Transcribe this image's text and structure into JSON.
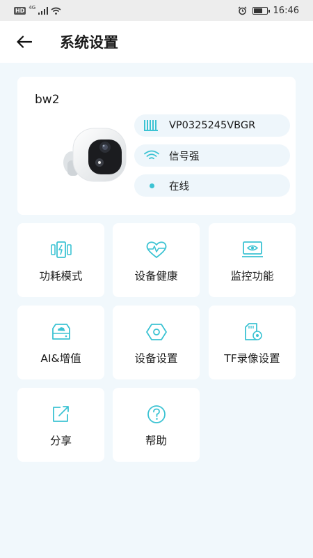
{
  "status_bar": {
    "network": "4G",
    "time": "16:46"
  },
  "header": {
    "title": "系统设置"
  },
  "device": {
    "name": "bw2",
    "serial": "VP0325245VBGR",
    "signal": "信号强",
    "status": "在线"
  },
  "menu": [
    {
      "label": "功耗模式",
      "icon": "battery-mode-icon"
    },
    {
      "label": "设备健康",
      "icon": "heart-pulse-icon"
    },
    {
      "label": "监控功能",
      "icon": "monitor-icon"
    },
    {
      "label": "AI&增值",
      "icon": "cloud-storage-icon"
    },
    {
      "label": "设备设置",
      "icon": "hexagon-settings-icon"
    },
    {
      "label": "TF录像设置",
      "icon": "sd-card-icon"
    },
    {
      "label": "分享",
      "icon": "share-icon"
    },
    {
      "label": "帮助",
      "icon": "help-icon"
    }
  ],
  "colors": {
    "accent": "#3cc3d3",
    "background": "#f1f8fc",
    "pill": "#eef6fb"
  }
}
